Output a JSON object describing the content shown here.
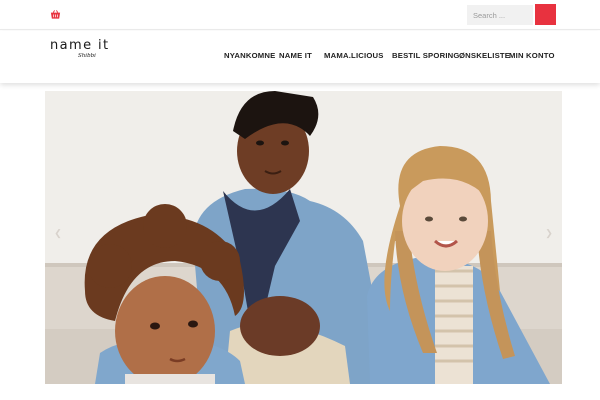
{
  "topbar": {
    "cart_icon": "basket-icon",
    "search_placeholder": "Search ...",
    "search_button_icon": "search-icon",
    "accent_color": "#e8323f"
  },
  "header": {
    "logo_text": "name it",
    "logo_subtext": "Shibbi"
  },
  "nav": {
    "items": [
      {
        "label": "NYANKOMNE"
      },
      {
        "label": "NAME IT"
      },
      {
        "label": "MAMA.LICIOUS"
      },
      {
        "label": "BESTIL SPORING"
      },
      {
        "label": "ØNSKELISTE"
      },
      {
        "label": "MIN KONTO"
      }
    ]
  },
  "slider": {
    "prev_icon": "chevron-left-icon",
    "next_icon": "chevron-right-icon",
    "image_alt": "Three children wearing denim jackets"
  }
}
